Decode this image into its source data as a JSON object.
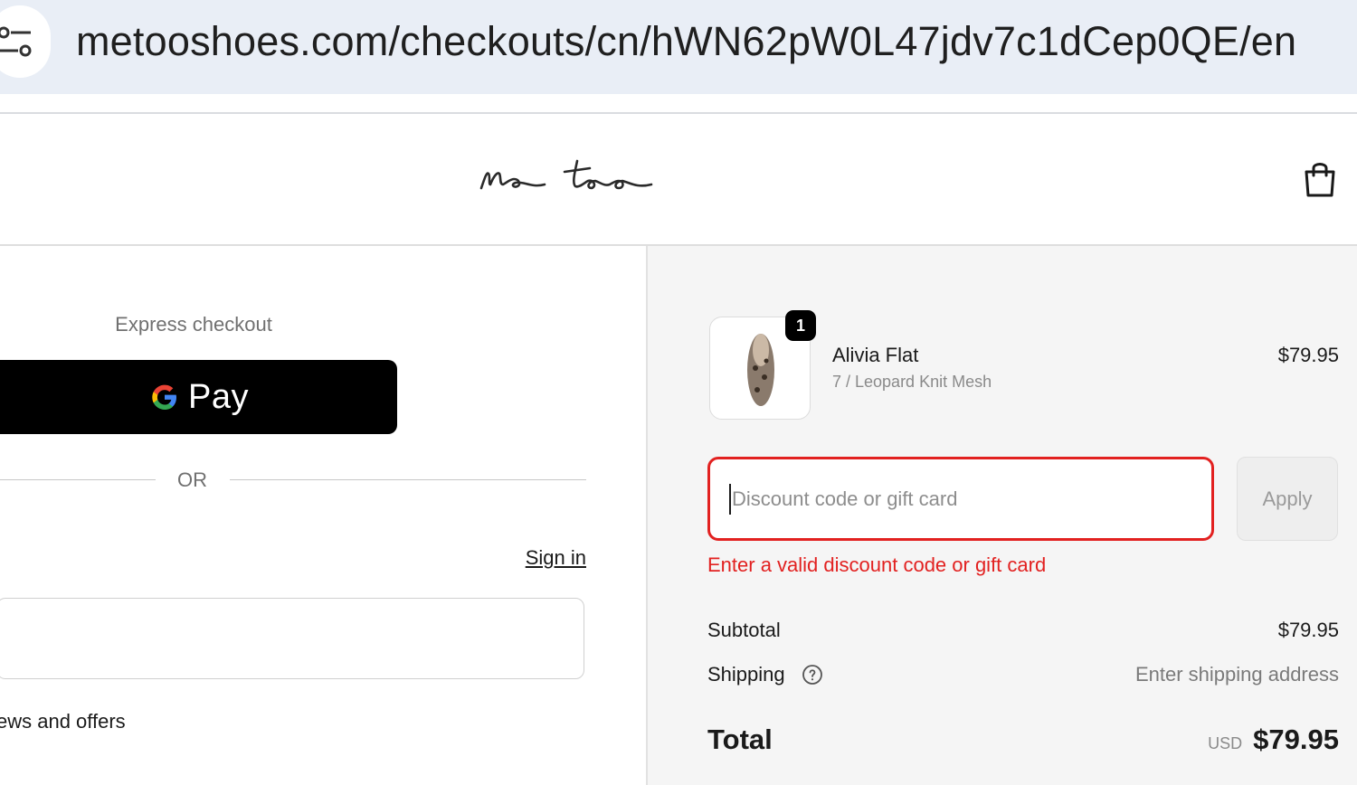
{
  "browser": {
    "url": "metooshoes.com/checkouts/cn/hWN62pW0L47jdv7c1dCep0QE/en",
    "site_info_icon": "tune-icon"
  },
  "header": {
    "logo_text": "me too",
    "cart_icon": "shopping-bag-icon"
  },
  "left": {
    "express_label": "Express checkout",
    "gpay_g": "G",
    "gpay_label": "Pay",
    "or_text": "OR",
    "signin_link": "Sign in",
    "email_value": "",
    "news_text": "ews and offers"
  },
  "summary": {
    "product": {
      "quantity": "1",
      "name": "Alivia Flat",
      "variant": "7 / Leopard Knit Mesh",
      "price": "$79.95"
    },
    "discount": {
      "placeholder": "Discount code or gift card",
      "value": "",
      "apply_label": "Apply",
      "error": "Enter a valid discount code or gift card"
    },
    "subtotal_label": "Subtotal",
    "subtotal_value": "$79.95",
    "shipping_label": "Shipping",
    "shipping_value": "Enter shipping address",
    "total_label": "Total",
    "currency": "USD",
    "total_value": "$79.95"
  },
  "colors": {
    "error": "#e22120",
    "gpay_background": "#000000",
    "summary_background": "#f5f5f5"
  }
}
